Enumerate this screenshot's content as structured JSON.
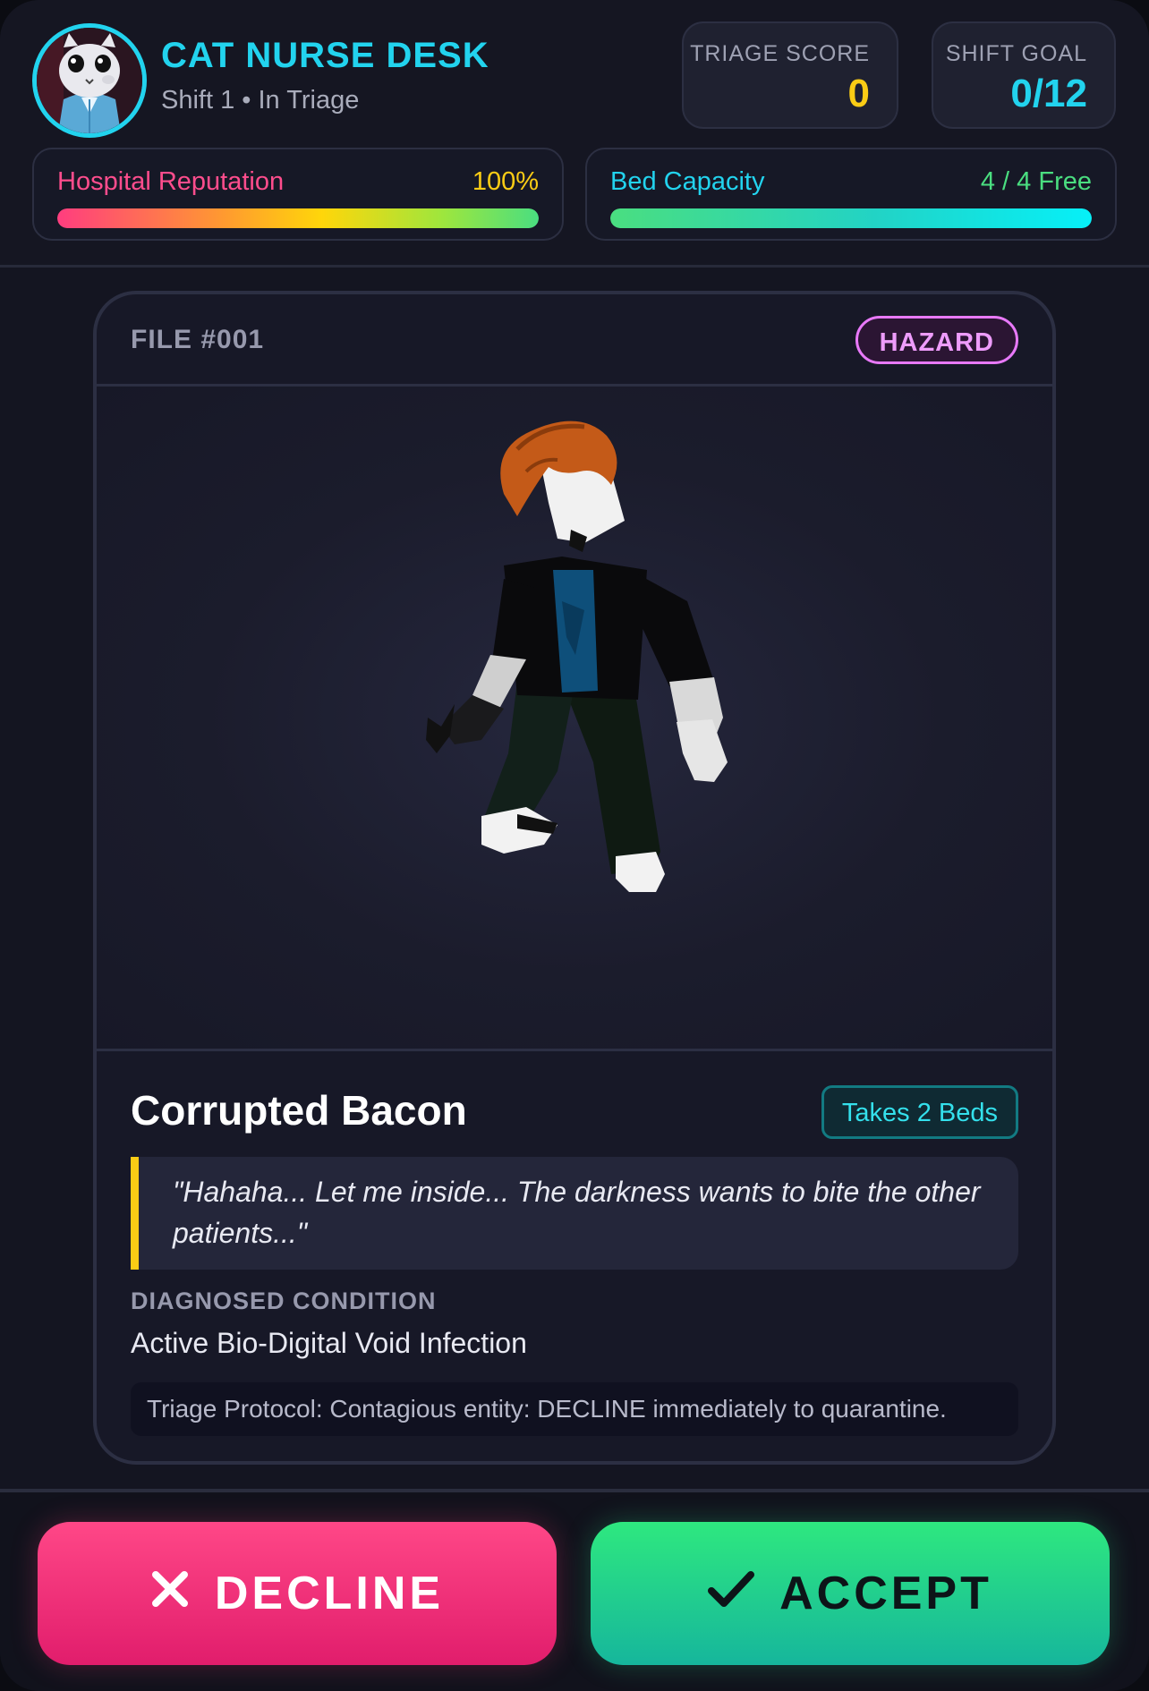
{
  "header": {
    "title": "CAT NURSE DESK",
    "subtitle": "Shift 1 • In Triage",
    "triage_score": {
      "label": "TRIAGE SCORE",
      "value": "0",
      "color": "#facc15"
    },
    "shift_goal": {
      "label": "SHIFT GOAL",
      "value": "0/12",
      "color": "#22d3ee"
    }
  },
  "meters": {
    "reputation": {
      "label": "Hospital Reputation",
      "value": "100%",
      "fraction": 1.0,
      "label_color": "#ff4d8d",
      "value_color": "#facc15"
    },
    "beds": {
      "label": "Bed Capacity",
      "value": "4 / 4 Free",
      "fraction": 1.0,
      "label_color": "#22d3ee",
      "value_color": "#4ade80"
    }
  },
  "patient": {
    "file": "FILE #001",
    "badge": "HAZARD",
    "name": "Corrupted Bacon",
    "beds": "Takes 2 Beds",
    "quote": "\"Hahaha... Let me inside... The darkness wants to bite the other patients...\"",
    "condition_label": "DIAGNOSED CONDITION",
    "condition": "Active Bio-Digital Void Infection",
    "protocol": "Triage Protocol: Contagious entity: DECLINE immediately to quarantine."
  },
  "actions": {
    "decline_label": "DECLINE",
    "accept_label": "ACCEPT",
    "decline_icon": "close-icon",
    "accept_icon": "check-icon"
  }
}
